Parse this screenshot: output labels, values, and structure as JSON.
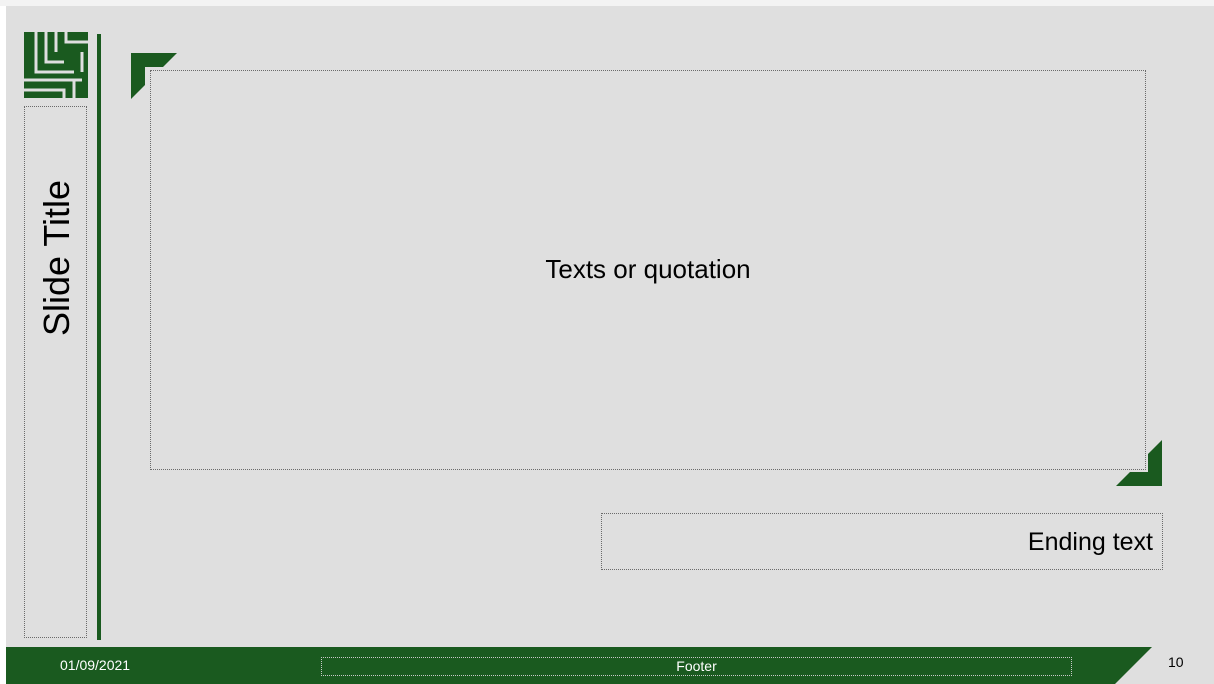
{
  "colors": {
    "accent_green": "#1a5a1f",
    "slide_background": "#dfdfdf",
    "placeholder_border": "#6a6a6a"
  },
  "slide": {
    "title": "Slide Title",
    "body_text": "Texts or quotation",
    "ending_text": "Ending text",
    "logo_icon": "green-geometric-logo-icon",
    "corner_icons": [
      "corner-triangle-top-left-icon",
      "corner-triangle-bottom-right-icon"
    ]
  },
  "footer": {
    "date": "01/09/2021",
    "text": "Footer",
    "page_number": "10"
  }
}
